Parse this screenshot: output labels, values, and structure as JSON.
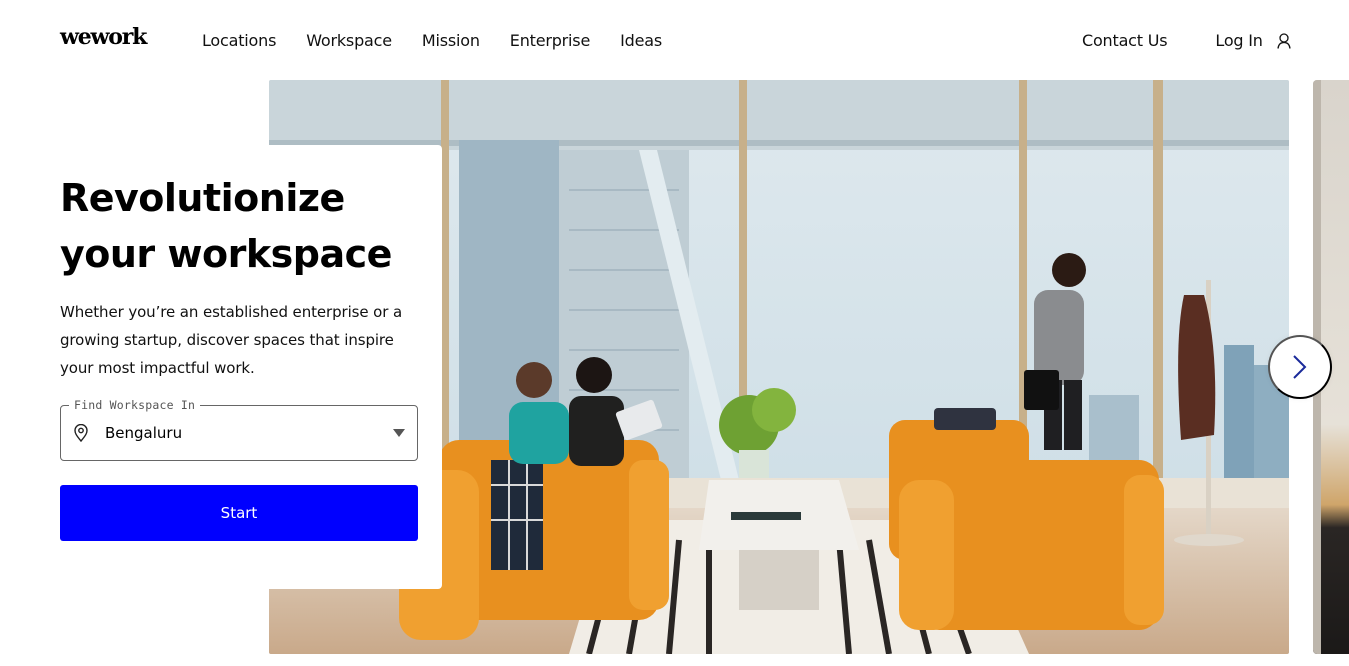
{
  "brand": {
    "logo_text": "wework",
    "accent_color": "#0000ff"
  },
  "nav": {
    "items": [
      {
        "label": "Locations"
      },
      {
        "label": "Workspace"
      },
      {
        "label": "Mission"
      },
      {
        "label": "Enterprise"
      },
      {
        "label": "Ideas"
      }
    ],
    "contact_label": "Contact Us",
    "login_label": "Log In",
    "user_icon": "user-icon"
  },
  "hero": {
    "headline": "Revolutionize your workspace",
    "subtext": "Whether you’re an established enterprise or a growing startup, discover spaces that inspire your most impactful work.",
    "location_field": {
      "label": "Find Workspace In",
      "value": "Bengaluru",
      "icon": "map-pin-icon"
    },
    "start_label": "Start"
  },
  "carousel": {
    "main_image_alt": "Office lounge with orange sofas, people working by floor-to-ceiling windows overlooking city skyline",
    "next_icon": "chevron-right-icon"
  }
}
